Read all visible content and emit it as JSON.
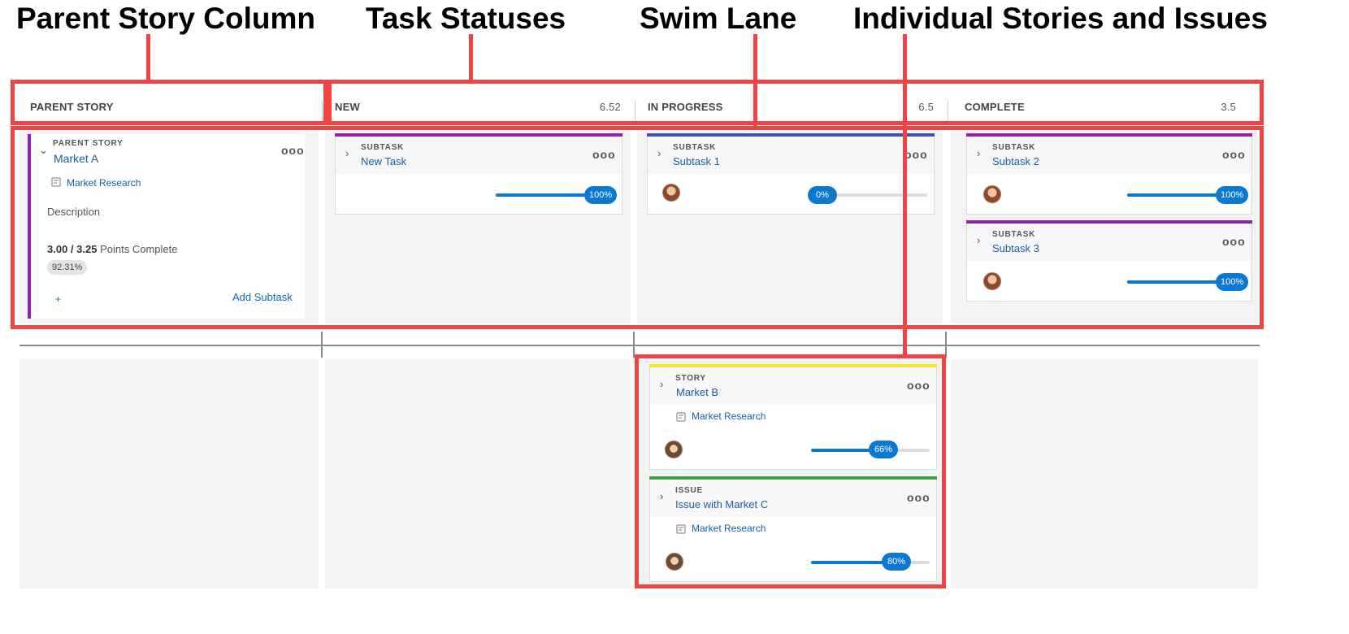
{
  "annotations": {
    "parent_story_column": "Parent Story Column",
    "task_statuses": "Task Statuses",
    "swim_lane": "Swim Lane",
    "individual_items": "Individual Stories and Issues"
  },
  "columns": [
    {
      "label": "PARENT STORY",
      "count": ""
    },
    {
      "label": "NEW",
      "count": "6.52"
    },
    {
      "label": "IN PROGRESS",
      "count": "6.5"
    },
    {
      "label": "COMPLETE",
      "count": "3.5"
    }
  ],
  "parent_story": {
    "kind": "PARENT STORY",
    "title": "Market A",
    "project": "Market Research",
    "description_label": "Description",
    "points_done": "3.00",
    "points_sep": " / ",
    "points_total": "3.25",
    "points_suffix": "Points Complete",
    "percent": "92.31%",
    "plus": "+",
    "add_subtask": "Add Subtask",
    "accent_color": "#8e24aa"
  },
  "lane1_cards": {
    "new_task": {
      "kind": "SUBTASK",
      "title": "New Task",
      "progress": "100%",
      "progress_value": 1.0,
      "accent": "#8e24aa"
    },
    "subtask1": {
      "kind": "SUBTASK",
      "title": "Subtask 1",
      "progress": "0%",
      "progress_value": 0.0,
      "accent": "#3f51b5"
    },
    "subtask2": {
      "kind": "SUBTASK",
      "title": "Subtask 2",
      "progress": "100%",
      "progress_value": 1.0,
      "accent": "#8e24aa"
    },
    "subtask3": {
      "kind": "SUBTASK",
      "title": "Subtask 3",
      "progress": "100%",
      "progress_value": 1.0,
      "accent": "#8e24aa"
    }
  },
  "lane2_cards": {
    "market_b": {
      "kind": "STORY",
      "title": "Market B",
      "project": "Market Research",
      "progress": "66%",
      "progress_value": 0.66,
      "accent": "#f5e52a"
    },
    "issue_c": {
      "kind": "ISSUE",
      "title": "Issue with Market C",
      "project": "Market Research",
      "progress": "80%",
      "progress_value": 0.8,
      "accent": "#43a047"
    }
  },
  "icons": {
    "chevron_down": "chevron-down-icon",
    "chevron_right": "chevron-right-icon",
    "more": "more-options-icon",
    "project": "project-icon",
    "avatar": "avatar"
  },
  "colors": {
    "annotation_red": "#ef4444",
    "progress_blue": "#0b78d1",
    "link_blue": "#1a5fa0"
  },
  "more_glyph": "ooo"
}
